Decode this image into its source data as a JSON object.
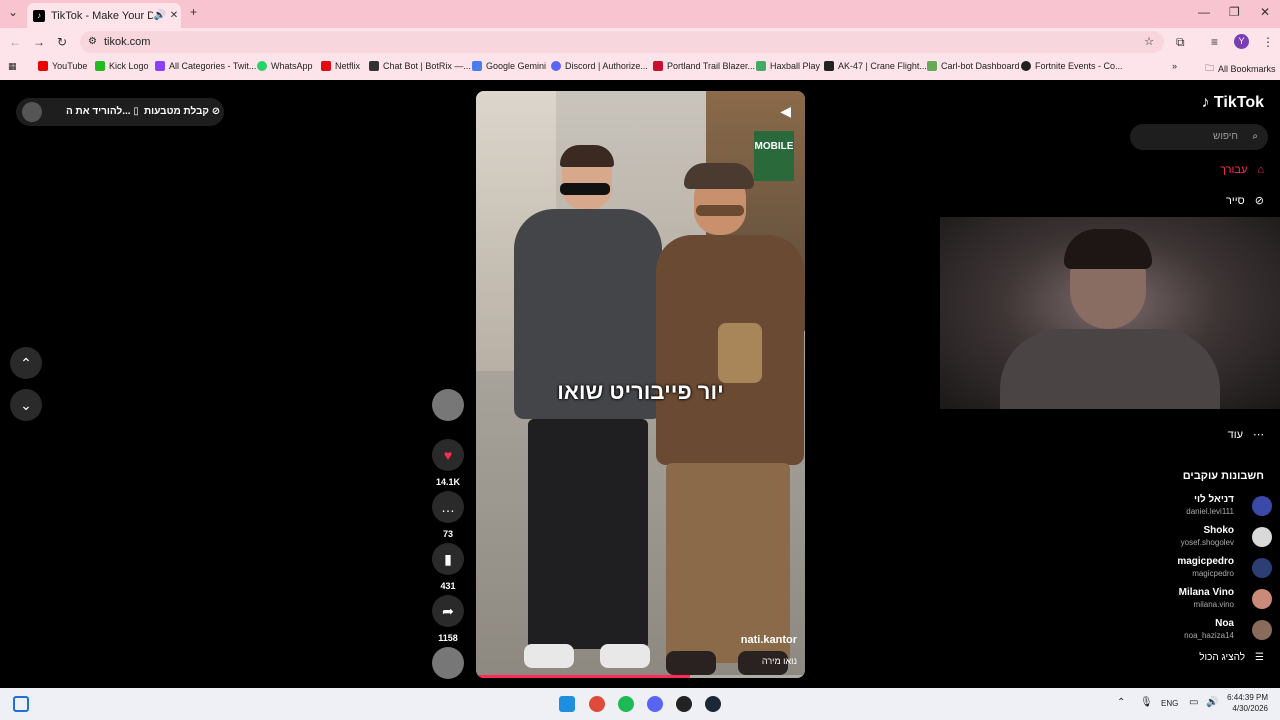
{
  "browser": {
    "tab_title": "TikTok - Make Your Day",
    "url": "tikok.com",
    "bookmarks": [
      "YouTube",
      "Kick Logo",
      "All Categories - Twit...",
      "WhatsApp",
      "Netflix",
      "Chat Bot | BotRix —...",
      "Google Gemini",
      "Discord | Authorize...",
      "Portland Trail Blazer...",
      "Haxball Play",
      "AK-47 | Crane Flight...",
      "Carl-bot Dashboard",
      "Fortnite Events - Co..."
    ],
    "all_bookmarks": "All Bookmarks",
    "profile_initial": "Y"
  },
  "promo": {
    "coins": "קבלת מטבעות",
    "download": "להוריד את ה..."
  },
  "video": {
    "caption": "יור פייבוריט שואו",
    "author": "nati.kantor",
    "music": "נואו מירה"
  },
  "actions": {
    "likes": "14.1K",
    "comments": "73",
    "saves": "431",
    "shares": "1158"
  },
  "sidebar": {
    "logo": "TikTok",
    "search_placeholder": "חיפוש",
    "nav_foryou": "עבורך",
    "nav_explore": "סייר",
    "nav_more": "עוד",
    "following_title": "חשבונות עוקבים",
    "accounts": [
      {
        "name": "דניאל לוי",
        "handle": "daniel.levi111",
        "color": "#3b4aa8"
      },
      {
        "name": "Shoko",
        "handle": "yosef.shogolev",
        "color": "#d9d9d9"
      },
      {
        "name": "magicpedro",
        "handle": "magicpedro",
        "color": "#2c3e73"
      },
      {
        "name": "Milana Vino",
        "handle": "milana.vino",
        "color": "#c98a7a"
      },
      {
        "name": "Noa",
        "handle": "noa_haziza14",
        "color": "#8a6a5a"
      }
    ],
    "show_all": "להציג הכול"
  },
  "taskbar": {
    "time": "6:44:39 PM",
    "date": "4/30/2026",
    "lang": "ENG"
  }
}
